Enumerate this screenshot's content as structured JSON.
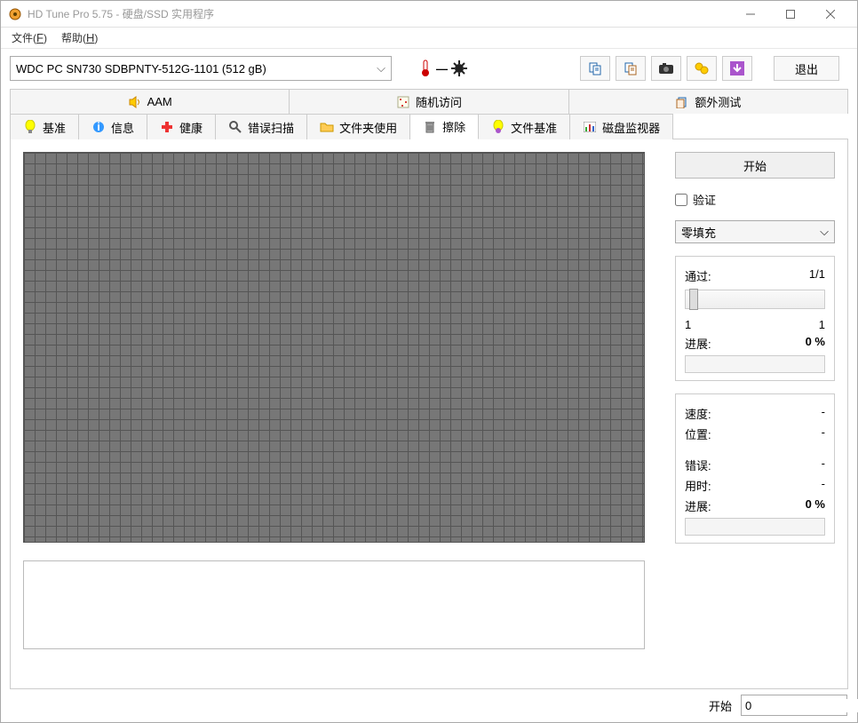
{
  "window": {
    "title": "HD Tune Pro 5.75 - 硬盘/SSD 实用程序"
  },
  "menu": {
    "file": "文件(F)",
    "file_key": "F",
    "help": "帮助(H)",
    "help_key": "H"
  },
  "toolbar": {
    "drive": "WDC PC SN730 SDBPNTY-512G-1101 (512 gB)",
    "temp_dash": "—",
    "exit": "退出"
  },
  "tabs_top": {
    "aam": "AAM",
    "random": "随机访问",
    "extra": "额外测试"
  },
  "tabs_bottom": {
    "benchmark": "基准",
    "info": "信息",
    "health": "健康",
    "errorscan": "错误扫描",
    "folder": "文件夹使用",
    "erase": "擦除",
    "filebench": "文件基准",
    "diskmon": "磁盘监视器"
  },
  "side": {
    "start": "开始",
    "verify": "验证",
    "fill_method": "零填充",
    "pass_label": "通过:",
    "pass_value": "1/1",
    "min": "1",
    "max": "1",
    "progress_label": "进展:",
    "progress_value": "0 %",
    "speed_label": "速度:",
    "speed_value": "-",
    "position_label": "位置:",
    "position_value": "-",
    "errors_label": "错误:",
    "errors_value": "-",
    "elapsed_label": "用时:",
    "elapsed_value": "-",
    "progress2_label": "进展:",
    "progress2_value": "0 %"
  },
  "bottom": {
    "start_label": "开始",
    "start_value": "0"
  }
}
